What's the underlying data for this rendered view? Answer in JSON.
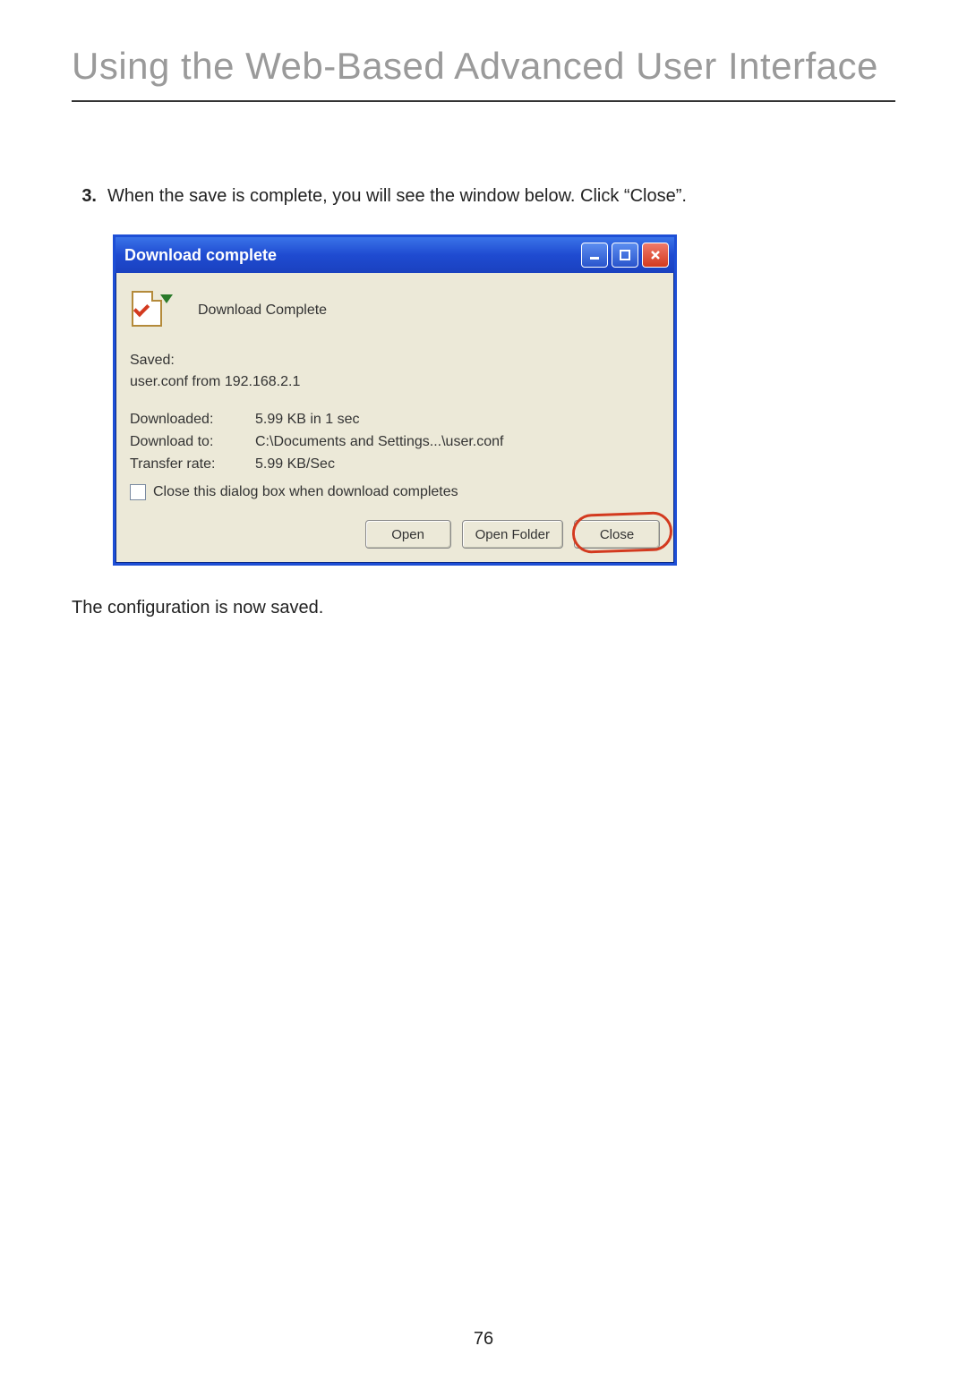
{
  "heading": "Using the Web-Based Advanced User Interface",
  "step": {
    "number": "3.",
    "text": "When the save is complete, you will see the window below. Click “Close”."
  },
  "dialog": {
    "title": "Download complete",
    "header_text": "Download Complete",
    "saved_label": "Saved:",
    "saved_file": "user.conf from 192.168.2.1",
    "rows": {
      "downloaded_label": "Downloaded:",
      "downloaded_value": "5.99 KB in 1 sec",
      "download_to_label": "Download to:",
      "download_to_value": "C:\\Documents and Settings...\\user.conf",
      "transfer_rate_label": "Transfer rate:",
      "transfer_rate_value": "5.99 KB/Sec"
    },
    "checkbox_label": "Close this dialog box when download completes",
    "buttons": {
      "open": "Open",
      "open_folder": "Open Folder",
      "close": "Close"
    }
  },
  "post_text": "The configuration is now saved.",
  "page_number": "76"
}
